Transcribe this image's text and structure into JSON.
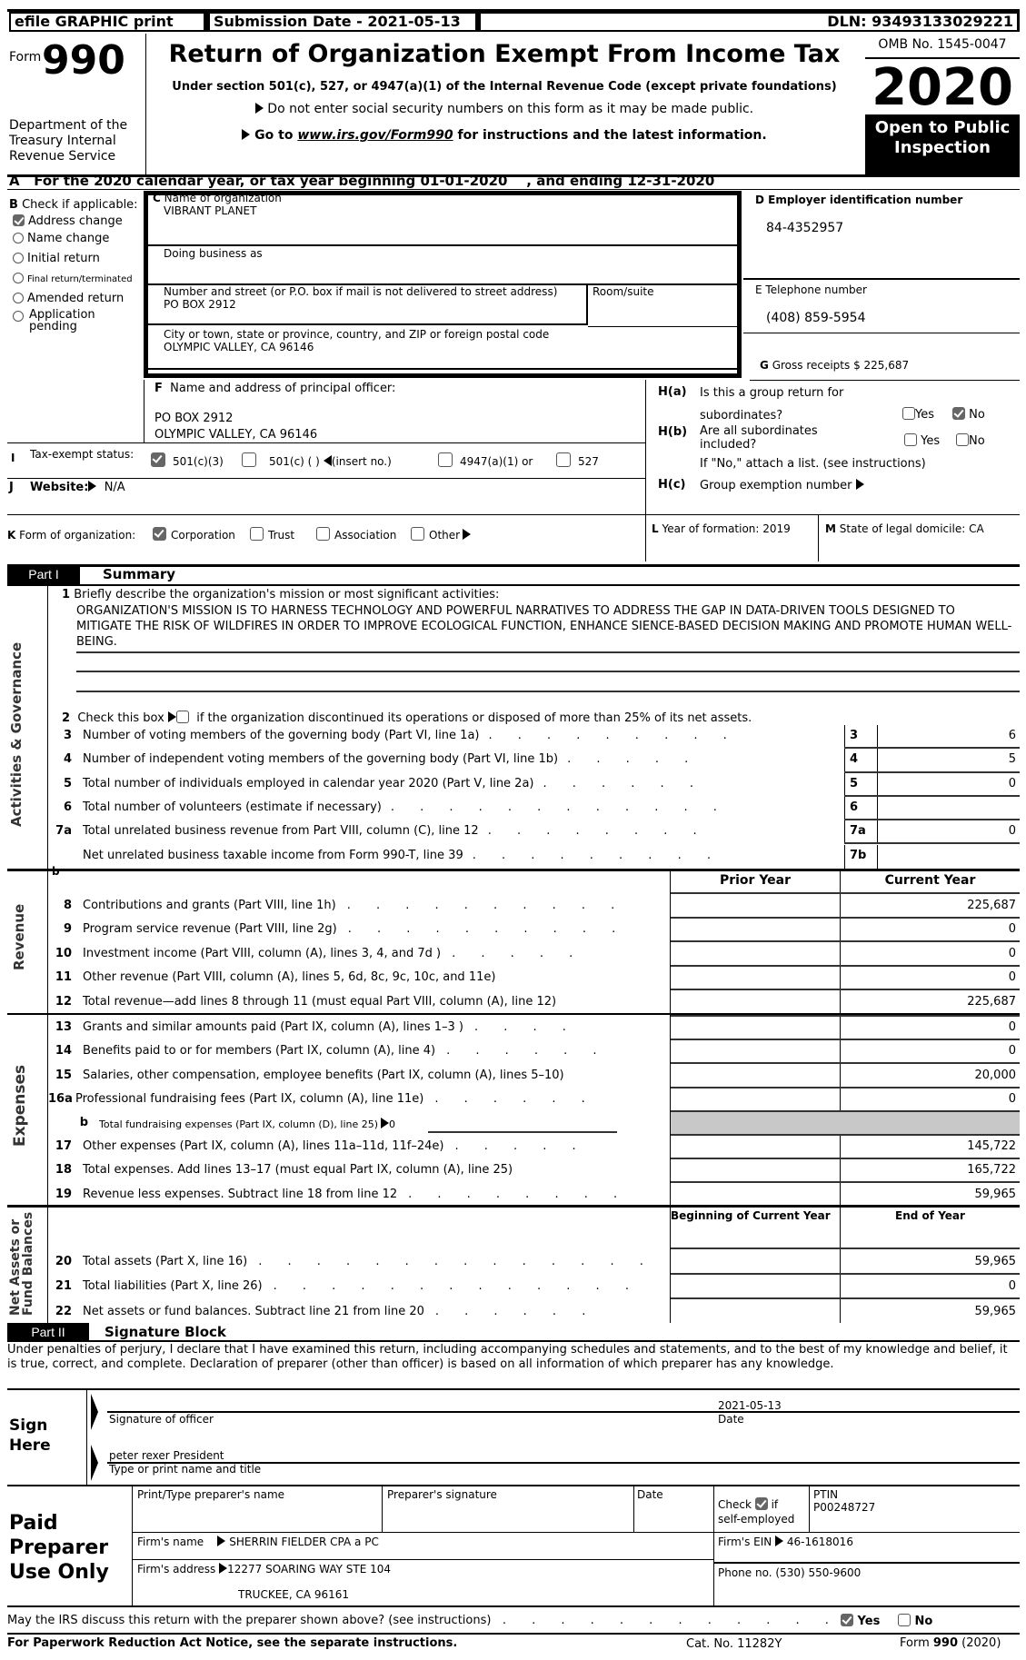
{
  "header": {
    "efile_label": "efile GRAPHIC print",
    "submission_date": "Submission Date - 2021-05-13",
    "dln": "DLN: 93493133029221",
    "form_prefix": "Form",
    "form_number": "990",
    "department": "Department of the Treasury Internal Revenue Service",
    "title": "Return of Organization Exempt From Income Tax",
    "subtitle": "Under section 501(c), 527, or 4947(a)(1) of the Internal Revenue Code (except private foundations)",
    "notice1": "Do not enter social security numbers on this form as it may be made public.",
    "notice2_prefix": "Go to ",
    "notice2_link": "www.irs.gov/Form990",
    "notice2_suffix": " for instructions and the latest information.",
    "omb": "OMB No. 1545-0047",
    "year": "2020",
    "open_public": "Open to Public Inspection"
  },
  "line_a": "A   For the 2020 calendar year, or tax year beginning 01-01-2020    , and ending 12-31-2020",
  "section_b": {
    "label_letter": "B",
    "label": "Check if applicable:",
    "items": [
      {
        "label": "Address change",
        "checked": true
      },
      {
        "label": "Name change",
        "checked": false
      },
      {
        "label": "Initial return",
        "checked": false
      },
      {
        "label": "Final return/terminated",
        "checked": false
      },
      {
        "label": "Amended return",
        "checked": false
      },
      {
        "label": "Application pending",
        "checked": false
      }
    ]
  },
  "section_c": {
    "name_label_letter": "C",
    "name_label": "Name of organization",
    "name": "VIBRANT PLANET",
    "dba_label": "Doing business as",
    "dba": "",
    "street_label": "Number and street (or P.O. box if mail is not delivered to street address)",
    "street": "PO BOX 2912",
    "room_label": "Room/suite",
    "city_label": "City or town, state or province, country, and ZIP or foreign postal code",
    "city": "OLYMPIC VALLEY, CA   96146"
  },
  "section_d": {
    "label": "D Employer identification number",
    "ein": "84-4352957"
  },
  "section_e": {
    "label": "E Telephone number",
    "phone": "(408) 859-5954"
  },
  "section_g": {
    "letter": "G",
    "label": "Gross receipts $ 225,687"
  },
  "section_f": {
    "letter": "F",
    "label": "Name and address of principal officer:",
    "line1": "PO BOX 2912",
    "line2": "OLYMPIC VALLEY, CA   96146"
  },
  "section_h": {
    "ha_label": "H(a)",
    "ha_text1": "Is this a group return for",
    "ha_text2": "subordinates?",
    "ha_yes": false,
    "ha_no": true,
    "hb_label": "H(b)",
    "hb_text1": "Are all subordinates",
    "hb_text2": "included?",
    "hb_yes": false,
    "hb_no": false,
    "hb_note": "If \"No,\" attach a list. (see instructions)",
    "hc_label": "H(c)",
    "hc_text": "Group exemption number",
    "yes_label": "Yes",
    "no_label": "No"
  },
  "section_i": {
    "letter": "I",
    "label": "Tax-exempt status:",
    "options": [
      {
        "label": "501(c)(3)",
        "checked": true
      },
      {
        "label": "501(c) (   )",
        "checked": false,
        "suffix": "(insert no.)"
      },
      {
        "label": "4947(a)(1) or",
        "checked": false
      },
      {
        "label": "527",
        "checked": false
      }
    ]
  },
  "section_j": {
    "letter": "J",
    "label": "Website:",
    "value": "N/A"
  },
  "section_k": {
    "letter": "K",
    "label": "Form of organization:",
    "options": [
      {
        "label": "Corporation",
        "checked": true
      },
      {
        "label": "Trust",
        "checked": false
      },
      {
        "label": "Association",
        "checked": false
      },
      {
        "label": "Other",
        "checked": false
      }
    ]
  },
  "section_l": {
    "letter": "L",
    "label": "Year of formation: 2019"
  },
  "section_m": {
    "letter": "M",
    "label": "State of legal domicile: CA"
  },
  "part1": {
    "part_label": "Part I",
    "title": "Summary",
    "side_activities": "Activities & Governance",
    "side_revenue": "Revenue",
    "side_expenses": "Expenses",
    "side_net_assets_1": "Net Assets or",
    "side_net_assets_2": "Fund Balances",
    "line1_num": "1",
    "line1_label": "Briefly describe the organization's mission or most significant activities:",
    "mission": "ORGANIZATION'S MISSION IS TO HARNESS TECHNOLOGY AND POWERFUL NARRATIVES TO ADDRESS THE GAP IN DATA-DRIVEN TOOLS DESIGNED TO MITIGATE THE RISK OF WILDFIRES IN ORDER TO IMPROVE ECOLOGICAL FUNCTION, ENHANCE SIENCE-BASED DECISION MAKING AND PROMOTE HUMAN WELL-BEING.",
    "line2_num": "2",
    "line2_pre": "Check this box",
    "line2_post": "if the organization discontinued its operations or disposed of more than 25% of its net assets.",
    "line2_checked": false,
    "gov_lines": [
      {
        "num": "3",
        "label": "Number of voting members of the governing body (Part VI, line 1a)",
        "dots": ". . . . . . . . .",
        "box": "3",
        "value": "6"
      },
      {
        "num": "4",
        "label": "Number of independent voting members of the governing body (Part VI, line 1b)",
        "dots": ". . . . .",
        "box": "4",
        "value": "5"
      },
      {
        "num": "5",
        "label": "Total number of individuals employed in calendar year 2020 (Part V, line 2a)",
        "dots": ". . . . . .",
        "box": "5",
        "value": "0"
      },
      {
        "num": "6",
        "label": "Total number of volunteers (estimate if necessary)",
        "dots": ". . . . . . . . . . . .",
        "box": "6",
        "value": ""
      },
      {
        "num": "7a",
        "label": "Total unrelated business revenue from Part VIII, column (C), line 12",
        "dots": ". . . . . . . .",
        "box": "7a",
        "value": "0"
      },
      {
        "num": "b",
        "label": "Net unrelated business taxable income from Form 990-T, line 39",
        "dots": ". . . . . . . . .",
        "box": "7b",
        "value": ""
      }
    ],
    "col_prior": "Prior Year",
    "col_current": "Current Year",
    "revenue_lines": [
      {
        "num": "8",
        "label": "Contributions and grants (Part VIII, line 1h)",
        "dots": ". . . . . . . . . .",
        "prior": "",
        "current": "225,687"
      },
      {
        "num": "9",
        "label": "Program service revenue (Part VIII, line 2g)",
        "dots": ". . . . . . . . . .",
        "prior": "",
        "current": "0"
      },
      {
        "num": "10",
        "label": "Investment income (Part VIII, column (A), lines 3, 4, and 7d )",
        "dots": ". . . . .",
        "prior": "",
        "current": "0"
      },
      {
        "num": "11",
        "label": "Other revenue (Part VIII, column (A), lines 5, 6d, 8c, 9c, 10c, and 11e)",
        "dots": "",
        "prior": "",
        "current": "0"
      },
      {
        "num": "12",
        "label": "Total revenue—add lines 8 through 11 (must equal Part VIII, column (A), line 12)",
        "dots": "",
        "prior": "",
        "current": "225,687"
      }
    ],
    "expense_lines": [
      {
        "num": "13",
        "label": "Grants and similar amounts paid (Part IX, column (A), lines 1–3 )",
        "dots": ". . . .",
        "prior": "",
        "current": "0"
      },
      {
        "num": "14",
        "label": "Benefits paid to or for members (Part IX, column (A), line 4)",
        "dots": ". . . . . .",
        "prior": "",
        "current": "0"
      },
      {
        "num": "15",
        "label": "Salaries, other compensation, employee benefits (Part IX, column (A), lines 5–10)",
        "dots": "",
        "prior": "",
        "current": "20,000"
      },
      {
        "num": "16a",
        "label": "Professional fundraising fees (Part IX, column (A), line 11e)",
        "dots": ". . . . . .",
        "prior": "",
        "current": "0"
      },
      {
        "num": "b",
        "label": "Total fundraising expenses (Part IX, column (D), line 25)",
        "value": "0"
      },
      {
        "num": "17",
        "label": "Other expenses (Part IX, column (A), lines 11a–11d, 11f–24e)",
        "dots": ". . . . .",
        "prior": "",
        "current": "145,722"
      },
      {
        "num": "18",
        "label": "Total expenses. Add lines 13–17 (must equal Part IX, column (A), line 25)",
        "dots": "",
        "prior": "",
        "current": "165,722"
      },
      {
        "num": "19",
        "label": "Revenue less expenses. Subtract line 18 from line 12",
        "dots": ". . . . . . . .",
        "prior": "",
        "current": "59,965"
      }
    ],
    "col_beginning": "Beginning of Current Year",
    "col_end": "End of Year",
    "net_lines": [
      {
        "num": "20",
        "label": "Total assets (Part X, line 16)",
        "dots": ". . . . . . . . . . . . . .",
        "begin": "",
        "end": "59,965"
      },
      {
        "num": "21",
        "label": "Total liabilities (Part X, line 26)",
        "dots": ". . . . . . . . . . . . .",
        "begin": "",
        "end": "0"
      },
      {
        "num": "22",
        "label": "Net assets or fund balances. Subtract line 21 from line 20",
        "dots": ". . . . . .",
        "begin": "",
        "end": "59,965"
      }
    ]
  },
  "part2": {
    "part_label": "Part II",
    "title": "Signature Block",
    "declaration": "Under penalties of perjury, I declare that I have examined this return, including accompanying schedules and statements, and to the best of my knowledge and belief, it is true, correct, and complete. Declaration of preparer (other than officer) is based on all information of which preparer has any knowledge.",
    "sign_here": "Sign Here",
    "sign_date": "2021-05-13",
    "sig_label": "Signature of officer",
    "date_label": "Date",
    "officer_name": "peter rexer  President",
    "name_title_label": "Type or print name and title"
  },
  "preparer": {
    "section_title": "Paid Preparer Use Only",
    "name_label": "Print/Type preparer's name",
    "name": "",
    "sig_label": "Preparer's signature",
    "date_label": "Date",
    "check_label": "Check",
    "check_if": "if",
    "self_employed_label": "self-employed",
    "self_employed": true,
    "ptin_label": "PTIN",
    "ptin": "P00248727",
    "firm_name_label": "Firm's name",
    "firm_name": "SHERRIN FIELDER CPA a PC",
    "firm_ein_label": "Firm's EIN",
    "firm_ein": "46-1618016",
    "firm_address_label": "Firm's address",
    "firm_address1": "12277 SOARING WAY STE 104",
    "firm_address2": "TRUCKEE, CA   96161",
    "phone_label": "Phone no.",
    "phone": "(530) 550-9600"
  },
  "footer": {
    "discuss_q": "May the IRS discuss this return with the preparer shown above? (see instructions)",
    "discuss_dots": ". . . . . . . . . . . .",
    "discuss_yes": true,
    "discuss_no": false,
    "yes_label": "Yes",
    "no_label": "No",
    "paperwork": "For Paperwork Reduction Act Notice, see the separate instructions.",
    "cat_no": "Cat. No. 11282Y",
    "form_prefix": "Form",
    "form_num": "990",
    "form_year": "(2020)"
  }
}
